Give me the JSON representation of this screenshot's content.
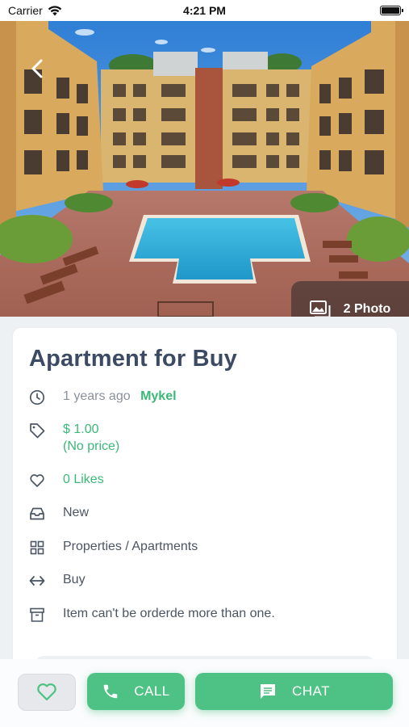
{
  "status_bar": {
    "carrier": "Carrier",
    "time": "4:21 PM"
  },
  "hero": {
    "photo_count_label": "2 Photo",
    "icons": [
      "back-chevron",
      "photo-gallery"
    ]
  },
  "item": {
    "title": "Apartment for Buy",
    "posted_time": "1 years ago",
    "seller": "Mykel",
    "price": "$ 1.00",
    "price_note": "(No price)",
    "likes": "0 Likes",
    "condition": "New",
    "category": "Properties / Apartments",
    "type": "Buy",
    "order_note": "Item can't be orderde more than one."
  },
  "actions": {
    "call_label": "CALL",
    "chat_label": "CHAT"
  },
  "colors": {
    "accent": "#4ec184",
    "title": "#3c4b63",
    "muted": "#8a919c"
  }
}
